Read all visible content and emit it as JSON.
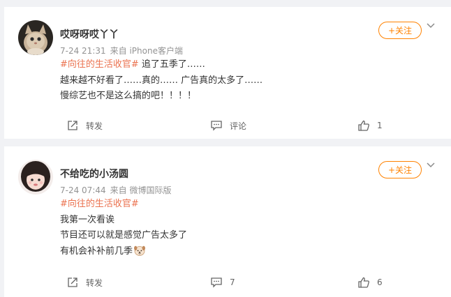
{
  "posts": [
    {
      "username": "哎呀呀哎丫丫",
      "time": "7-24 21:31",
      "source": "来自 iPhone客户端",
      "follow_label": "+关注",
      "topic": "#向往的生活收官#",
      "line1_rest": " 追了五季了……",
      "line2": "越来越不好看了……真的…… 广告真的太多了……",
      "line3": "慢综艺也不是这么搞的吧！！！！",
      "repost_label": "转发",
      "comment_label": "评论",
      "like_count": "1",
      "avatar": "cat-photo"
    },
    {
      "username": "不给吃的小汤圆",
      "time": "7-24 07:44",
      "source": "来自 微博国际版",
      "follow_label": "+关注",
      "topic": "#向往的生活收官#",
      "line2": "我第一次看诶",
      "line3": "节目还可以就是感觉广告太多了",
      "line4": "有机会补补前几季",
      "repost_label": "转发",
      "comment_count": "7",
      "like_count": "6",
      "avatar": "girl-photo"
    }
  ],
  "colors": {
    "accent": "#ff8200",
    "topic": "#eb7350",
    "meta": "#939393",
    "background": "#f1f2f5"
  },
  "icons": [
    "repost-icon",
    "comment-icon",
    "like-icon",
    "chevron-down-icon",
    "dog-emoji-icon"
  ]
}
